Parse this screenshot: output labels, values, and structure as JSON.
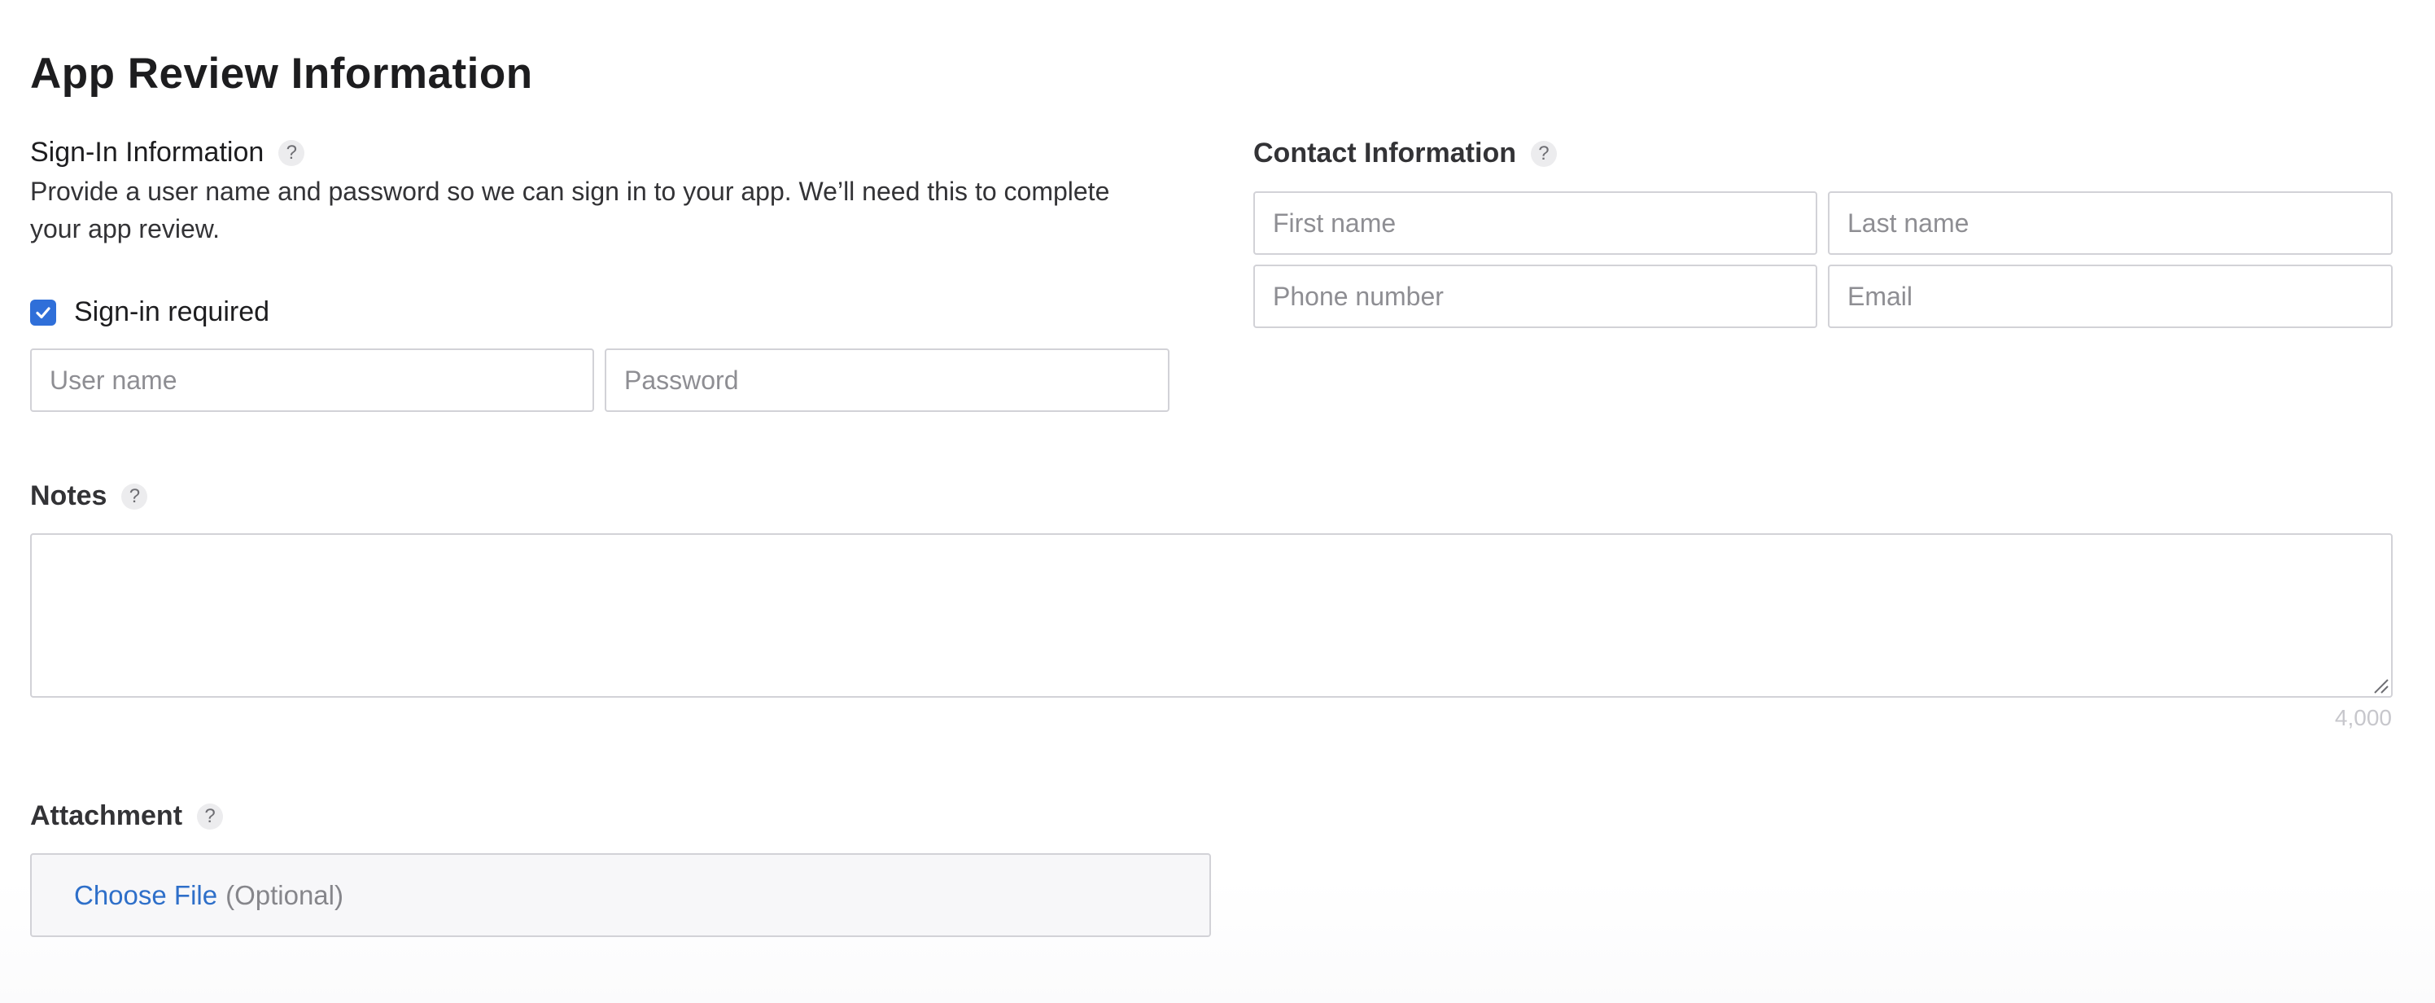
{
  "page": {
    "title": "App Review Information"
  },
  "sign_in": {
    "heading": "Sign-In Information",
    "help": "?",
    "description": "Provide a user name and password so we can sign in to your app. We’ll need this to complete your app review.",
    "checkbox_label": "Sign-in required",
    "checkbox_checked": true,
    "username_placeholder": "User name",
    "username_value": "",
    "password_placeholder": "Password",
    "password_value": ""
  },
  "contact": {
    "heading": "Contact Information",
    "help": "?",
    "first_name_placeholder": "First name",
    "last_name_placeholder": "Last name",
    "phone_placeholder": "Phone number",
    "email_placeholder": "Email"
  },
  "notes": {
    "heading": "Notes",
    "help": "?",
    "value": "",
    "char_limit": "4,000"
  },
  "attachment": {
    "heading": "Attachment",
    "help": "?",
    "choose_file": "Choose File",
    "optional": "(Optional)"
  },
  "colors": {
    "accent": "#2e6fc9",
    "checkbox": "#2f6fd9",
    "border": "#d2d2d7",
    "help_bg": "#ececee"
  }
}
